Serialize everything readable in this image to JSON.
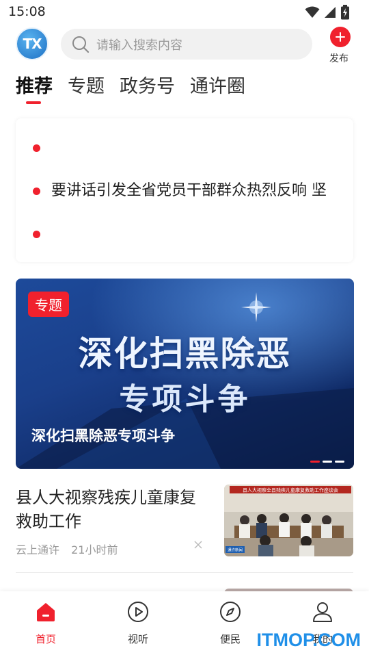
{
  "status_bar": {
    "time": "15:08"
  },
  "header": {
    "logo_text": "TX",
    "search_placeholder": "请输入搜索内容",
    "publish_label": "发布"
  },
  "tabs": [
    {
      "label": "推荐",
      "active": true
    },
    {
      "label": "专题",
      "active": false
    },
    {
      "label": "政务号",
      "active": false
    },
    {
      "label": "通许圈",
      "active": false
    }
  ],
  "ticker": {
    "items": [
      "",
      "要讲话引发全省党员干部群众热烈反响 坚",
      ""
    ]
  },
  "banner": {
    "tag": "专题",
    "headline_line1": "深化扫黑除恶",
    "headline_line2": "专项斗争",
    "caption": "深化扫黑除恶专项斗争",
    "slide_count": 3,
    "active_slide": 0
  },
  "news": [
    {
      "title": "县人大视察残疾儿童康复救助工作",
      "source": "云上通许",
      "time": "21小时前",
      "thumb_banner": "县人大视察全县残疾儿童康复救助工作座谈会",
      "thumb_logo": "通许新闻"
    }
  ],
  "bottom_nav": [
    {
      "label": "首页",
      "icon": "home-icon",
      "active": true
    },
    {
      "label": "视听",
      "icon": "play-circle-icon",
      "active": false
    },
    {
      "label": "便民",
      "icon": "compass-icon",
      "active": false
    },
    {
      "label": "我的",
      "icon": "user-icon",
      "active": false
    }
  ],
  "watermark": "ITMOP.COM",
  "colors": {
    "accent": "#f0212d",
    "logo_blue": "#1d6fc4",
    "watermark": "#1f8fe8"
  }
}
